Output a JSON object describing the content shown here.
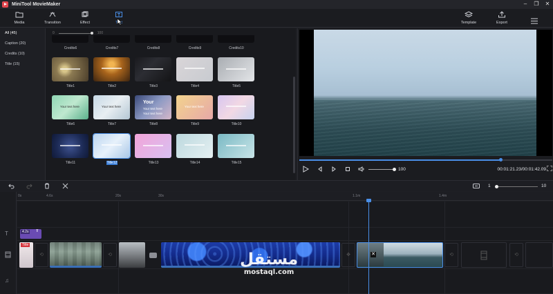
{
  "app": {
    "title": "MiniTool MovieMaker",
    "window_controls": [
      "–",
      "❐",
      "✕"
    ]
  },
  "toolbar": {
    "media": {
      "label": "Media",
      "icon": "folder-icon"
    },
    "transition": {
      "label": "Transition",
      "icon": "transition-icon"
    },
    "effect": {
      "label": "Effect",
      "icon": "effect-icon"
    },
    "text": {
      "label": "Text",
      "icon": "text-icon"
    },
    "template": {
      "label": "Template",
      "icon": "layers-icon"
    },
    "export": {
      "label": "Export",
      "icon": "export-icon"
    },
    "menu": {
      "icon": "hamburger-menu-icon"
    }
  },
  "nav": {
    "items": [
      "All (45)",
      "Caption (20)",
      "Credits (10)",
      "Title (15)"
    ]
  },
  "library": {
    "slider_min": "0",
    "slider_max": "100",
    "credits_row": [
      "Credits6",
      "Credits7",
      "Credits8",
      "Credits9",
      "Credits10"
    ],
    "titles": [
      "Title1",
      "Title2",
      "Title3",
      "Title4",
      "Title5",
      "Title6",
      "Title7",
      "Title8",
      "Title9",
      "Title10",
      "Title11",
      "Title12",
      "Title13",
      "Title14",
      "Title15"
    ],
    "selected_index": 11,
    "tile_text_large": "Your",
    "tile_text_small": "Your text here"
  },
  "preview": {
    "volume": "100",
    "timecode": "00:01:21.23/00:01:42.09",
    "progress": 0.795,
    "volume_level": 1.0
  },
  "timeline": {
    "zoom_min": "1",
    "zoom_max": "10",
    "zoom_level": 0.0,
    "ruler": [
      "0s",
      "4.6s",
      "20s",
      "30s",
      "1.1m",
      "1.4m"
    ],
    "text_clip_duration": "4.2s",
    "title_clip_label": "Title"
  },
  "watermark": {
    "arabic": "مستقل",
    "latin": "mostaql.com"
  }
}
